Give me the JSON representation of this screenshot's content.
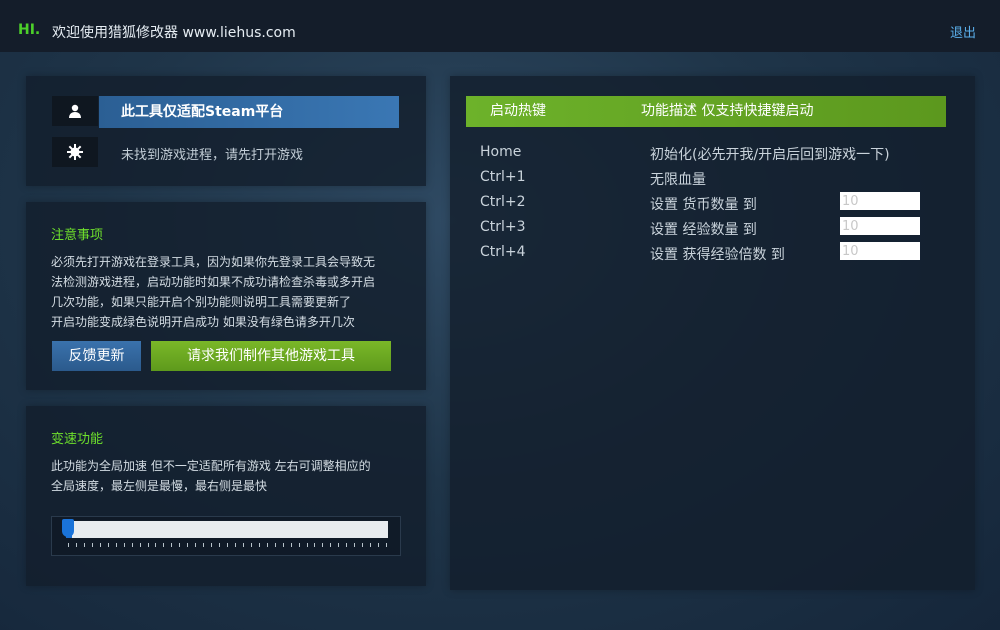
{
  "header": {
    "greeting": "HI.",
    "welcome": "欢迎使用猎狐修改器 www.liehus.com",
    "exit_label": "退出"
  },
  "info": {
    "user_icon": "user-icon",
    "status_icon": "gear-icon",
    "steam_label": "此工具仅适配Steam平台",
    "status_text": "未找到游戏进程，请先打开游戏"
  },
  "notes": {
    "title": "注意事项",
    "lines": [
      "必须先打开游戏在登录工具，因为如果你先登录工具会导致无",
      "法检测游戏进程，启动功能时如果不成功请检查杀毒或多开启",
      "几次功能，如果只能开启个别功能则说明工具需要更新了",
      "开启功能变成绿色说明开启成功 如果没有绿色请多开几次"
    ],
    "feedback_label": "反馈更新",
    "request_label": "请求我们制作其他游戏工具"
  },
  "speed": {
    "title": "变速功能",
    "lines": [
      "此功能为全局加速 但不一定适配所有游戏 左右可调整相应的",
      "全局速度，最左侧是最慢，最右侧是最快"
    ],
    "slider_value": 0
  },
  "hotkeys": {
    "col_key": "启动热键",
    "col_desc": "功能描述 仅支持快捷键启动",
    "rows": [
      {
        "key": "Home",
        "desc": "初始化(必先开我/开启后回到游戏一下)",
        "input": null
      },
      {
        "key": "Ctrl+1",
        "desc": "无限血量",
        "input": null
      },
      {
        "key": "Ctrl+2",
        "desc": "设置 货币数量 到",
        "input": "10"
      },
      {
        "key": "Ctrl+3",
        "desc": "设置 经验数量 到",
        "input": "10"
      },
      {
        "key": "Ctrl+4",
        "desc": "设置 获得经验倍数 到",
        "input": "10"
      }
    ]
  },
  "colors": {
    "accent_green": "#6db22a",
    "accent_blue": "#3a77b4",
    "link_blue": "#5aaeea",
    "title_green": "#6ee02c"
  }
}
